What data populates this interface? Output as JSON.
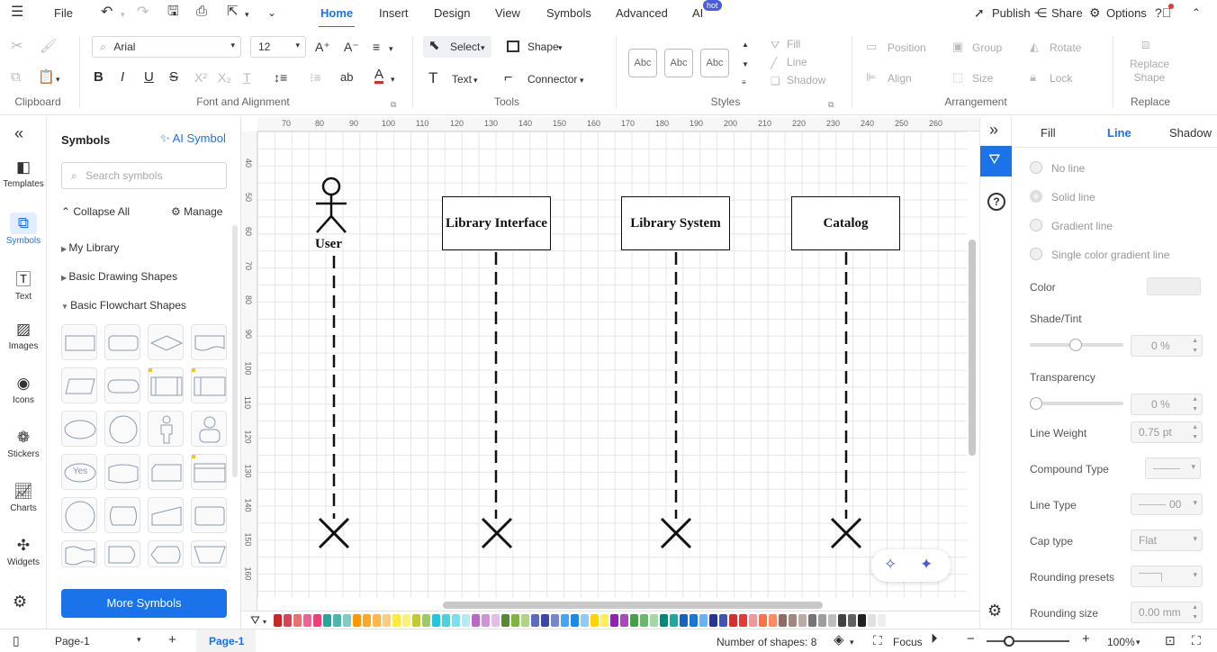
{
  "menubar": {
    "file": "File",
    "tabs": [
      "Home",
      "Insert",
      "Design",
      "View",
      "Symbols",
      "Advanced",
      "AI"
    ],
    "ai_badge": "hot",
    "publish": "Publish",
    "share": "Share",
    "options": "Options"
  },
  "ribbon": {
    "font_name": "Arial",
    "font_size": "12",
    "select": "Select",
    "shape": "Shape",
    "text": "Text",
    "connector": "Connector",
    "style_sample": "Abc",
    "fill": "Fill",
    "line": "Line",
    "shadow": "Shadow",
    "position": "Position",
    "group": "Group",
    "rotate": "Rotate",
    "align": "Align",
    "size": "Size",
    "lock": "Lock",
    "replace_shape": "Replace Shape",
    "groups": {
      "clipboard": "Clipboard",
      "font": "Font and Alignment",
      "tools": "Tools",
      "styles": "Styles",
      "arrangement": "Arrangement",
      "replace": "Replace"
    }
  },
  "leftnav": [
    "Templates",
    "Symbols",
    "Text",
    "Images",
    "Icons",
    "Stickers",
    "Charts",
    "Widgets"
  ],
  "symbols": {
    "title": "Symbols",
    "ai_symbol": "AI Symbol",
    "search_placeholder": "Search symbols",
    "collapse_all": "Collapse All",
    "manage": "Manage",
    "categories": [
      "My Library",
      "Basic Drawing Shapes",
      "Basic Flowchart Shapes"
    ],
    "yes_shape": "Yes",
    "more_symbols": "More Symbols"
  },
  "ruler": {
    "top": [
      "70",
      "80",
      "90",
      "100",
      "110",
      "120",
      "130",
      "140",
      "150",
      "160",
      "170",
      "180",
      "190",
      "200",
      "210",
      "220",
      "230",
      "240",
      "250",
      "260"
    ],
    "left": [
      "40",
      "50",
      "60",
      "70",
      "80",
      "90",
      "100",
      "110",
      "120",
      "130",
      "140",
      "150",
      "160"
    ]
  },
  "diagram": {
    "actor_label": "User",
    "objects": [
      "Library Interface",
      "Library System",
      "Catalog"
    ]
  },
  "properties": {
    "tabs": [
      "Fill",
      "Line",
      "Shadow"
    ],
    "line_options": [
      "No line",
      "Solid line",
      "Gradient line",
      "Single color gradient line"
    ],
    "color": "Color",
    "shade_tint": "Shade/Tint",
    "shade_value": "0 %",
    "transparency": "Transparency",
    "transparency_value": "0 %",
    "line_weight": "Line Weight",
    "line_weight_value": "0.75 pt",
    "compound_type": "Compound Type",
    "line_type": "Line Type",
    "line_type_value": "00",
    "cap_type": "Cap type",
    "cap_value": "Flat",
    "rounding_presets": "Rounding presets",
    "rounding_size": "Rounding size",
    "rounding_size_value": "0.00 mm"
  },
  "status": {
    "page_select": "Page-1",
    "page_tab": "Page-1",
    "shape_count": "Number of shapes: 8",
    "focus": "Focus",
    "zoom": "100%"
  },
  "palette": [
    "#c62828",
    "#d84354",
    "#e57373",
    "#f06292",
    "#ec407a",
    "#26a69a",
    "#4db6ac",
    "#80cbc4",
    "#ff9800",
    "#ffa726",
    "#ffb74d",
    "#ffcc80",
    "#ffeb3b",
    "#fff176",
    "#c0ca33",
    "#9ccc65",
    "#26c6da",
    "#4dd0e1",
    "#80deea",
    "#b2ebf2",
    "#ba68c8",
    "#ce93d8",
    "#e1bee7",
    "#558b2f",
    "#7cb342",
    "#aed581",
    "#5c6bc0",
    "#3949ab",
    "#7986cb",
    "#42a5f5",
    "#1e88e5",
    "#90caf9",
    "#ffd600",
    "#ffee58",
    "#8e24aa",
    "#ab47bc",
    "#43a047",
    "#66bb6a",
    "#a5d6a7",
    "#00897b",
    "#26a69a",
    "#1565c0",
    "#1976d2",
    "#64b5f6",
    "#283593",
    "#3f51b5",
    "#d32f2f",
    "#e53935",
    "#ef9a9a",
    "#ff7043",
    "#ff8a65",
    "#8d6e63",
    "#a1887f",
    "#bcaaa4",
    "#757575",
    "#9e9e9e",
    "#bdbdbd",
    "#424242",
    "#616161",
    "#212121",
    "#e0e0e0",
    "#eeeeee"
  ]
}
